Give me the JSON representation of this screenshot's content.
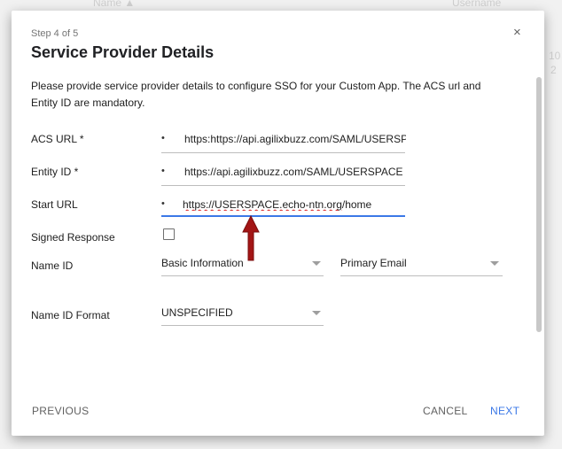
{
  "background": {
    "left_text": "Name ▲",
    "right_text": "Username",
    "side_text_1": "10",
    "side_text_2": "2"
  },
  "dialog": {
    "step": "Step 4 of 5",
    "title": "Service Provider Details",
    "close_label": "×",
    "intro": "Please provide service provider details to configure SSO for your Custom App. The ACS url and Entity ID are mandatory.",
    "bullet": "•",
    "fields": {
      "acs": {
        "label": "ACS URL *",
        "value": "https:https://api.agilixbuzz.com/SAML/USERSPACE"
      },
      "entity": {
        "label": "Entity ID *",
        "value": "https://api.agilixbuzz.com/SAML/USERSPACE"
      },
      "start": {
        "label": "Start URL",
        "value_prefix": "https://",
        "value_mid": "USERSPACE.echo-ntn.org",
        "value_suffix": "/home"
      }
    },
    "signed_response": {
      "label": "Signed Response",
      "checked": false
    },
    "name_id": {
      "label": "Name ID",
      "category": "Basic Information",
      "attribute": "Primary Email"
    },
    "name_id_format": {
      "label": "Name ID Format",
      "value": "UNSPECIFIED"
    },
    "buttons": {
      "previous": "PREVIOUS",
      "cancel": "CANCEL",
      "next": "NEXT"
    }
  },
  "colors": {
    "accent": "#3b78e7",
    "annotation_arrow": "#a31515"
  }
}
